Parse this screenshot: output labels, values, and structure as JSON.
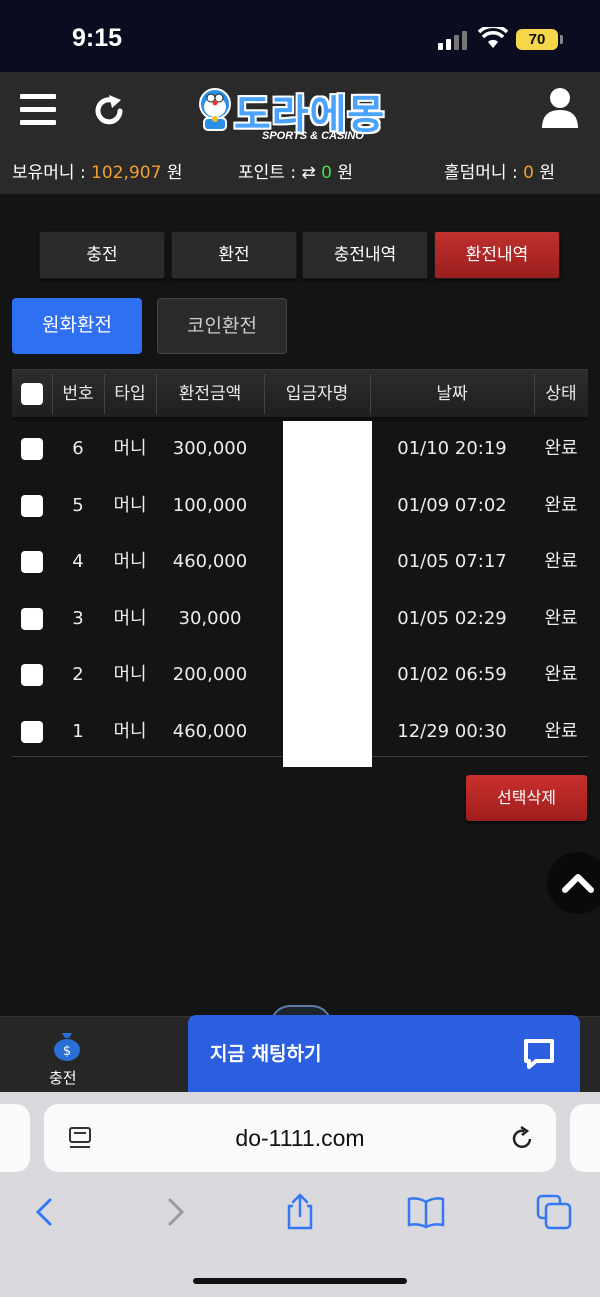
{
  "status_bar": {
    "time": "9:15",
    "battery": "70"
  },
  "header": {
    "logo_text": "도라에몽",
    "logo_sub": "SPORTS & CASINO",
    "info": {
      "money_label": "보유머니 : ",
      "money_value": "102,907",
      "money_unit": " 원",
      "point_label": "포인트 : ",
      "point_value": "0",
      "point_unit": " 원",
      "holdem_label": "홀덤머니 : ",
      "holdem_value": "0",
      "holdem_unit": " 원"
    }
  },
  "tabs": {
    "charge": "충전",
    "exchange": "환전",
    "charge_history": "충전내역",
    "exchange_history": "환전내역"
  },
  "sub_tabs": {
    "won": "원화환전",
    "coin": "코인환전"
  },
  "table": {
    "headers": {
      "no": "번호",
      "type": "타입",
      "amount": "환전금액",
      "depositor": "입금자명",
      "date": "날짜",
      "status": "상태"
    },
    "rows": [
      {
        "no": "6",
        "type": "머니",
        "amount": "300,000",
        "date": "01/10 20:19",
        "status": "완료"
      },
      {
        "no": "5",
        "type": "머니",
        "amount": "100,000",
        "date": "01/09 07:02",
        "status": "완료"
      },
      {
        "no": "4",
        "type": "머니",
        "amount": "460,000",
        "date": "01/05 07:17",
        "status": "완료"
      },
      {
        "no": "3",
        "type": "머니",
        "amount": "30,000",
        "date": "01/05 02:29",
        "status": "완료"
      },
      {
        "no": "2",
        "type": "머니",
        "amount": "200,000",
        "date": "01/02 06:59",
        "status": "완료"
      },
      {
        "no": "1",
        "type": "머니",
        "amount": "460,000",
        "date": "12/29 00:30",
        "status": "완료"
      }
    ]
  },
  "delete_button": "선택삭제",
  "bottom_nav": {
    "charge": "충전"
  },
  "chat": {
    "label": "지금 채팅하기"
  },
  "browser": {
    "url": "do-1111.com"
  },
  "colors": {
    "accent_red": "#b52826",
    "accent_blue": "#2f6ff2",
    "chat_blue": "#2b5fe0",
    "money_orange": "#f0a030",
    "point_green": "#4ad64a"
  }
}
